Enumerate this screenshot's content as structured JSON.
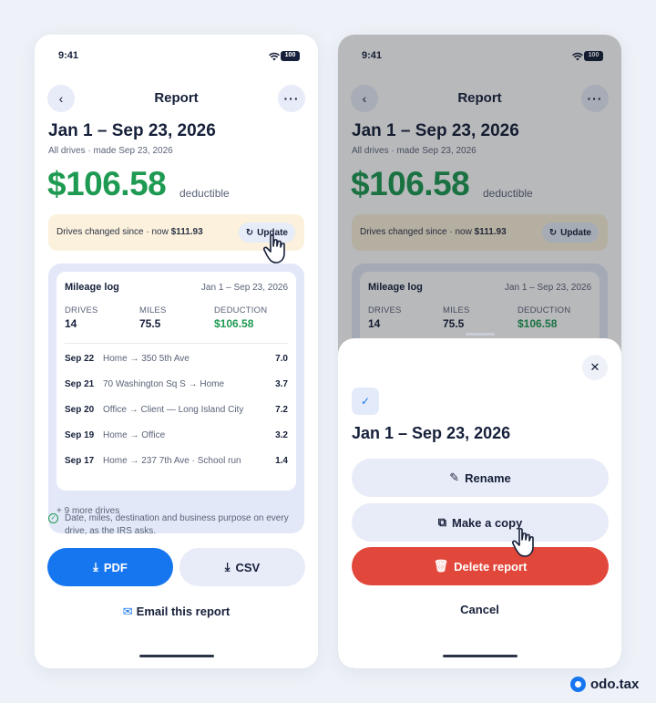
{
  "status": {
    "time": "9:41",
    "battery": "100"
  },
  "header": {
    "title": "Report"
  },
  "report": {
    "range": "Jan 1 – Sep 23, 2026",
    "subtitle": "All drives · made Sep 23, 2026",
    "amount": "$106.58",
    "amount_label": "deductible"
  },
  "banner": {
    "text": "Drives changed since · now ",
    "new_amount": "$111.93",
    "update_label": "Update"
  },
  "mileage_log": {
    "title": "Mileage log",
    "range": "Jan 1 – Sep 23, 2026",
    "stats": [
      {
        "label": "DRIVES",
        "value": "14"
      },
      {
        "label": "MILES",
        "value": "75.5"
      },
      {
        "label": "DEDUCTION",
        "value": "$106.58"
      }
    ],
    "drives": [
      {
        "date": "Sep 22",
        "route": "Home → 350 5th Ave",
        "miles": "7.0"
      },
      {
        "date": "Sep 21",
        "route": "70 Washington Sq S → Home",
        "miles": "3.7"
      },
      {
        "date": "Sep 20",
        "route": "Office → Client — Long Island City",
        "miles": "7.2"
      },
      {
        "date": "Sep 19",
        "route": "Home → Office",
        "miles": "3.2"
      },
      {
        "date": "Sep 17",
        "route": "Home → 237 7th Ave · School run",
        "miles": "1.4"
      }
    ],
    "more": "+ 9 more drives"
  },
  "note": "Date, miles, destination and business purpose on every drive, as the IRS asks.",
  "actions": {
    "pdf": "PDF",
    "csv": "CSV",
    "email": "Email this report"
  },
  "sheet": {
    "title": "Jan 1 – Sep 23, 2026",
    "rename": "Rename",
    "copy": "Make a copy",
    "delete": "Delete report",
    "cancel": "Cancel"
  },
  "brand": {
    "name": "odo.tax"
  },
  "colors": {
    "accent": "#1676f0",
    "positive": "#1e9a52",
    "danger": "#e2473b",
    "banner": "#fbf1dc"
  }
}
